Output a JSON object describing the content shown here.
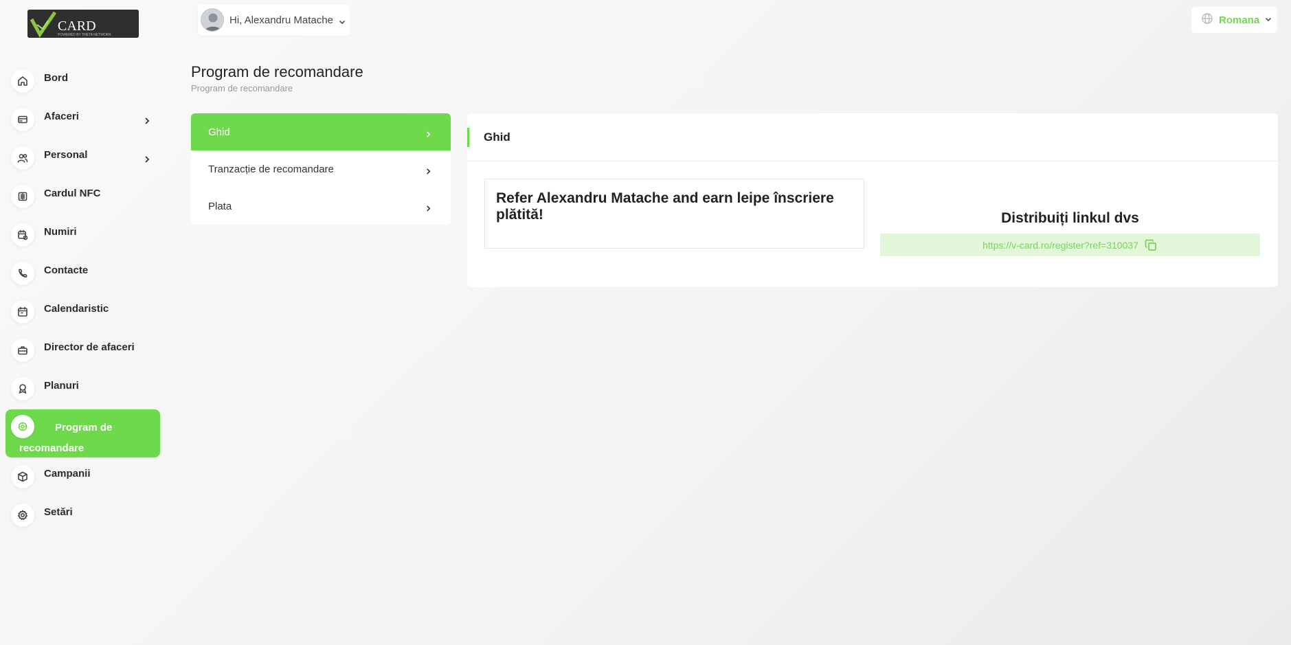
{
  "brand": {
    "logo_text": "CARD",
    "logo_tagline": "POWERED BY THETA NETWORK",
    "accent_color": "#6fd94c"
  },
  "sidebar": {
    "items": [
      {
        "label": "Bord",
        "icon": "home-icon"
      },
      {
        "label": "Afaceri",
        "icon": "card-icon",
        "has_submenu": true
      },
      {
        "label": "Personal",
        "icon": "users-icon",
        "has_submenu": true
      },
      {
        "label": "Cardul NFC",
        "icon": "nfc-icon"
      },
      {
        "label": "Numiri",
        "icon": "calendar-clock-icon"
      },
      {
        "label": "Contacte",
        "icon": "phone-icon"
      },
      {
        "label": "Calendaristic",
        "icon": "calendar-icon"
      },
      {
        "label": "Director de afaceri",
        "icon": "briefcase-icon"
      },
      {
        "label": "Planuri",
        "icon": "award-icon"
      },
      {
        "label": "Program de recomandare",
        "icon": "referral-icon",
        "active": true
      },
      {
        "label": "Campanii",
        "icon": "box-icon"
      },
      {
        "label": "Setări",
        "icon": "gear-icon"
      }
    ]
  },
  "topbar": {
    "user_greeting": "Hi, Alexandru Matache",
    "language": "Romana"
  },
  "page": {
    "title": "Program de recomandare",
    "breadcrumb": "Program de recomandare"
  },
  "menu": {
    "items": [
      {
        "label": "Ghid",
        "active": true
      },
      {
        "label": "Tranzacție de recomandare"
      },
      {
        "label": "Plata"
      }
    ]
  },
  "main": {
    "title": "Ghid",
    "refer_text": "Refer Alexandru Matache and earn leipe înscriere plătită!",
    "share_title": "Distribuiți linkul dvs",
    "share_url": "https://v-card.ro/register?ref=310037"
  }
}
